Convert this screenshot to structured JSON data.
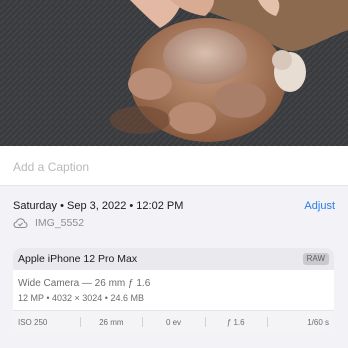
{
  "caption": {
    "placeholder": "Add a Caption",
    "value": ""
  },
  "info": {
    "date_line": "Saturday • Sep 3, 2022 • 12:02 PM",
    "adjust_label": "Adjust",
    "cloud_icon": "cloud-icon",
    "filename": "IMG_5552"
  },
  "device": {
    "name": "Apple iPhone 12 Pro Max",
    "badge": "RAW",
    "lens": "Wide Camera — 26 mm ƒ 1.6",
    "specs": "12 MP  •  4032 × 3024  •  24.6 MB",
    "exif": {
      "iso": "ISO 250",
      "focal": "26 mm",
      "exposure": "0 ev",
      "aperture": "ƒ 1.6",
      "shutter": "1/60 s"
    }
  },
  "colors": {
    "accent": "#2c7be5",
    "info_background": "#f2f2f7"
  }
}
